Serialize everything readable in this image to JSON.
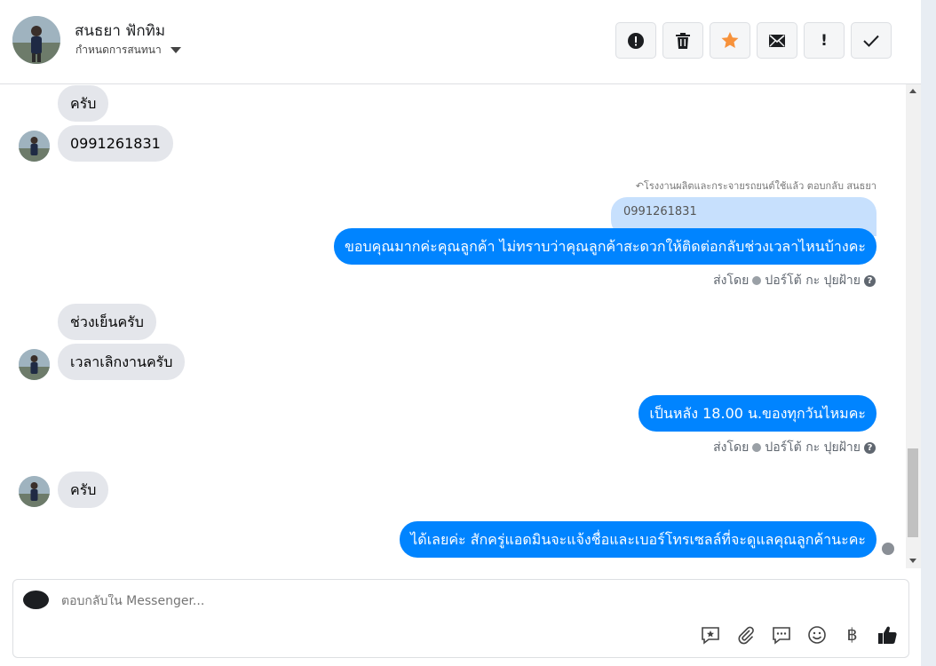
{
  "header": {
    "contact_name": "สนธยา ฟักทิม",
    "subtitle": "กำหนดการสนทนา",
    "toolbar": [
      {
        "name": "spam-button",
        "icon": "alert-circle-icon"
      },
      {
        "name": "delete-button",
        "icon": "trash-icon"
      },
      {
        "name": "star-button",
        "icon": "star-icon",
        "color": "#f7923b"
      },
      {
        "name": "mark-unread-button",
        "icon": "mail-icon"
      },
      {
        "name": "follow-up-button",
        "icon": "exclamation-icon",
        "label": "!"
      },
      {
        "name": "done-button",
        "icon": "check-icon"
      }
    ]
  },
  "thread": {
    "messages": [
      {
        "dir": "in",
        "text": "ครับ"
      },
      {
        "dir": "in",
        "text": "0991261831"
      },
      {
        "dir": "out",
        "reply_note": "โรงงานผลิตและกระจายรถยนต์ใช้แล้ว ตอบกลับ สนธยา",
        "quoted": "0991261831",
        "text": "ขอบคุณมากค่ะคุณลูกค้า ไม่ทราบว่าคุณลูกค้าสะดวกให้ติดต่อกลับช่วงเวลาไหนบ้างคะ",
        "meta_prefix": "ส่งโดย",
        "meta_sender": "ปอร์โต้ กะ ปุยฝ้าย"
      },
      {
        "dir": "in",
        "text": "ช่วงเย็นครับ"
      },
      {
        "dir": "in",
        "text": "เวลาเลิกงานครับ"
      },
      {
        "dir": "out",
        "text": "เป็นหลัง 18.00 น.ของทุกวันไหมคะ",
        "meta_prefix": "ส่งโดย",
        "meta_sender": "ปอร์โต้ กะ ปุยฝ้าย"
      },
      {
        "dir": "in",
        "text": "ครับ"
      },
      {
        "dir": "out",
        "text": "ได้เลยค่ะ สักครู่แอดมินจะแจ้งชื่อและเบอร์โทรเซลล์ที่จะดูแลคุณลูกค้านะคะ"
      }
    ],
    "help_icon": "?"
  },
  "composer": {
    "placeholder": "ตอบกลับใน Messenger...",
    "icons": [
      "saved-reply-icon",
      "attachment-icon",
      "chat-bubble-icon",
      "emoji-icon",
      "baht-icon",
      "like-icon"
    ],
    "baht_symbol": "฿"
  },
  "colors": {
    "outgoing": "#0084ff",
    "incoming": "#e4e6eb",
    "star": "#f7923b"
  }
}
